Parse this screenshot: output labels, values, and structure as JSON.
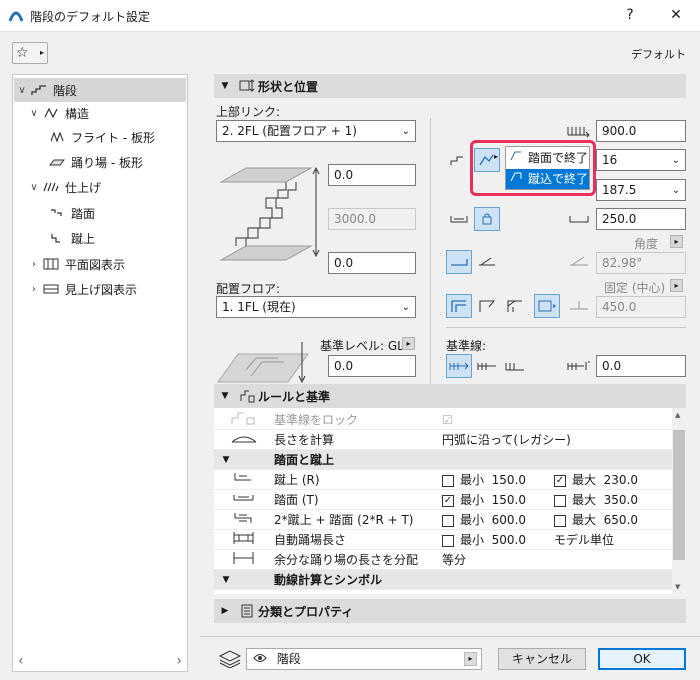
{
  "window": {
    "title": "階段のデフォルト設定",
    "help": "?",
    "close": "✕"
  },
  "toolbar": {
    "favorites_glyph": "☆",
    "favorites_arrow": "▸",
    "default_label": "デフォルト"
  },
  "tree": {
    "items": [
      {
        "label": "階段",
        "toggle": "∨",
        "icon": "stair-icon"
      },
      {
        "label": "構造",
        "toggle": "∨",
        "icon": "structure-icon"
      },
      {
        "label": "フライト - 板形",
        "toggle": "",
        "icon": "flight-icon"
      },
      {
        "label": "踊り場 - 板形",
        "toggle": "",
        "icon": "landing-icon"
      },
      {
        "label": "仕上げ",
        "toggle": "∨",
        "icon": "finish-icon"
      },
      {
        "label": "踏面",
        "toggle": "",
        "icon": "tread-icon"
      },
      {
        "label": "蹴上",
        "toggle": "",
        "icon": "riser-icon"
      },
      {
        "label": "平面図表示",
        "toggle": "›",
        "icon": "floorplan-icon"
      },
      {
        "label": "見上げ図表示",
        "toggle": "›",
        "icon": "ceiling-icon"
      }
    ],
    "scroll_left": "‹",
    "scroll_right": "›"
  },
  "shape": {
    "title": "形状と位置",
    "toggle": "▼",
    "top_link_label": "上部リンク:",
    "top_link_value": "2. 2FL (配置フロア + 1)",
    "top_offset": "0.0",
    "height": "3000.0",
    "bottom_offset": "0.0",
    "home_story_label": "配置フロア:",
    "home_story_value": "1. 1FL (現在)",
    "ref_level_label": "基準レベル: GL",
    "ref_level_value": "0.0",
    "total_width": "900.0",
    "riser_count": "16",
    "riser_height": "187.5",
    "tread_depth": "250.0",
    "angle_label": "角度",
    "angle_value": "82.98°",
    "fixed_label": "固定 (中心)",
    "fixed_value": "450.0",
    "baseline_label": "基準線:",
    "baseline_offset": "0.0"
  },
  "popup": {
    "items": [
      "踏面で終了",
      "蹴込で終了"
    ],
    "highlighted": 1
  },
  "rules": {
    "title": "ルールと基準",
    "toggle": "▼",
    "rows": [
      {
        "type": "row",
        "name": "基準線をロック",
        "value": "☑",
        "disabled": true
      },
      {
        "type": "row",
        "name": "長さを計算",
        "value": "円弧に沿って(レガシー)"
      },
      {
        "type": "group",
        "name": "踏面と蹴上"
      },
      {
        "type": "check",
        "name": "蹴上 (R)",
        "min_checked": false,
        "min_label": "最小",
        "min": "150.0",
        "max_checked": true,
        "max_label": "最大",
        "max": "230.0"
      },
      {
        "type": "check",
        "name": "踏面 (T)",
        "min_checked": true,
        "min_label": "最小",
        "min": "150.0",
        "max_checked": false,
        "max_label": "最大",
        "max": "350.0"
      },
      {
        "type": "check",
        "name": "2*蹴上 + 踏面 (2*R + T)",
        "min_checked": false,
        "min_label": "最小",
        "min": "600.0",
        "max_checked": false,
        "max_label": "最大",
        "max": "650.0"
      },
      {
        "type": "check2",
        "name": "自動踊場長さ",
        "min_checked": false,
        "min_label": "最小",
        "min": "500.0",
        "extra": "モデル単位"
      },
      {
        "type": "row",
        "name": "余分な踊り場の長さを分配",
        "value": "等分"
      },
      {
        "type": "group",
        "name": "動線計算とシンボル"
      }
    ]
  },
  "classification": {
    "title": "分類とプロパティ",
    "toggle": "▶"
  },
  "footer": {
    "layer_value": "階段",
    "cancel": "キャンセル",
    "ok": "OK"
  },
  "colors": {
    "accent": "#0078d7",
    "highlight_border": "#e8305b",
    "section_bg": "#dcdcdc"
  }
}
